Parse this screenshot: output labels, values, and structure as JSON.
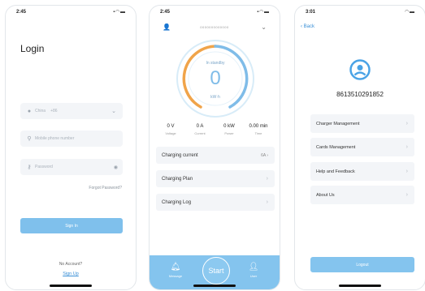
{
  "login": {
    "time": "2:45",
    "title": "Login",
    "country": "China",
    "country_code": "+86",
    "phone_placeholder": "Mobile phone number",
    "password_placeholder": "Password",
    "forgot": "Forgot Password?",
    "signin": "Sign In",
    "no_account": "No Account?",
    "signup": "Sign Up"
  },
  "dashboard": {
    "time": "2:45",
    "device_id": "0000000000000",
    "gauge": {
      "state": "In standby",
      "value": "0",
      "unit": "kW·h"
    },
    "stats": [
      {
        "value": "0 V",
        "label": "Voltage"
      },
      {
        "value": "0 A",
        "label": "Current"
      },
      {
        "value": "0 kW",
        "label": "Power"
      },
      {
        "value": "0.00 min",
        "label": "Time"
      }
    ],
    "menu": [
      {
        "label": "Charging current",
        "value": "6A"
      },
      {
        "label": "Charging Plan"
      },
      {
        "label": "Charging Log"
      }
    ],
    "nav": {
      "message": "Message",
      "start": "Start",
      "user": "User"
    }
  },
  "user": {
    "time": "3:01",
    "back": "Back",
    "username": "8613510291852",
    "menu": [
      {
        "label": "Charger Management"
      },
      {
        "label": "Cards Management"
      },
      {
        "label": "Help and Feedback"
      },
      {
        "label": "About Us"
      }
    ],
    "logout": "Logout"
  },
  "status_icons": "signal-wifi-battery",
  "colors": {
    "accent": "#84c4ee",
    "link": "#3a8fd6",
    "gauge_orange": "#f0a44a",
    "gauge_blue": "#7fbce8"
  }
}
